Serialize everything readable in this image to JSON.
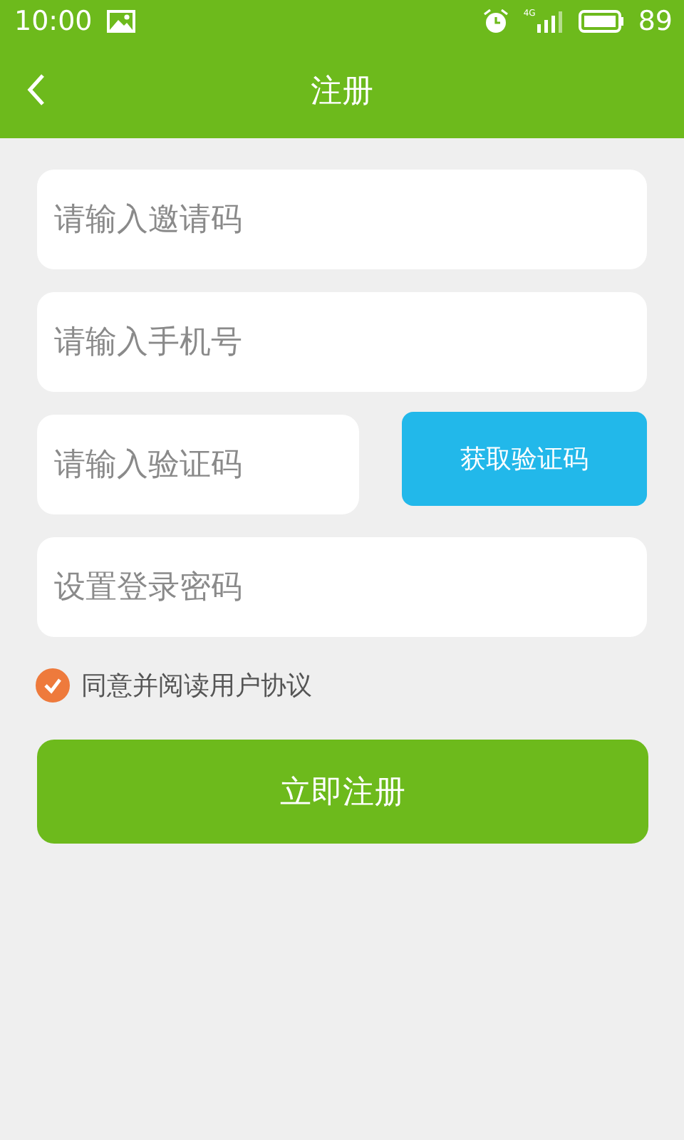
{
  "status_bar": {
    "time": "10:00",
    "network": "4G",
    "battery": "89"
  },
  "header": {
    "title": "注册"
  },
  "fields": [
    {
      "placeholder": "请输入邀请码"
    },
    {
      "placeholder": "请输入手机号"
    },
    {
      "placeholder": "请输入验证码",
      "button": "获取验证码"
    },
    {
      "placeholder": "设置登录密码"
    }
  ],
  "agreement": {
    "label": "同意并阅读用户协议",
    "checked": true
  },
  "submit": "立即注册"
}
